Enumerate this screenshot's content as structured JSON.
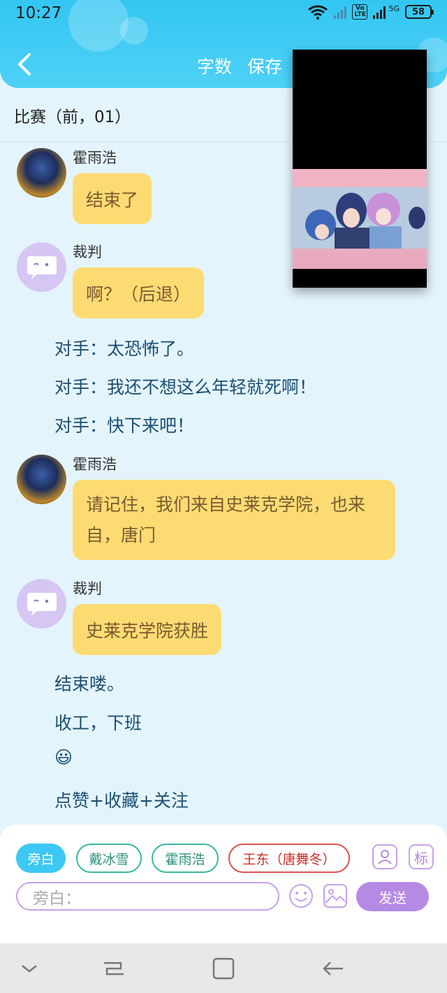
{
  "status_bar": {
    "time": "10:27",
    "network": "5G",
    "battery": "58",
    "volte": "Vo LTE"
  },
  "header": {
    "word_count": "字数",
    "save": "保存"
  },
  "chapter_title": "比赛（前，01）",
  "messages": [
    {
      "sender": "霍雨浩",
      "text": "结束了",
      "avatar": "huo-yuhao-avatar"
    },
    {
      "sender": "裁判",
      "text": "啊？（后退）",
      "avatar": "referee-avatar"
    },
    {
      "sender": "霍雨浩",
      "text": "请记住，我们来自史莱克学院，也来自，唐门",
      "avatar": "huo-yuhao-avatar"
    },
    {
      "sender": "裁判",
      "text": "史莱克学院获胜",
      "avatar": "referee-avatar"
    }
  ],
  "narration": [
    "对手：太恐怖了。",
    "对手：我还不想这么年轻就死啊！",
    "对手：快下来吧！",
    "结束喽。",
    "收工，下班",
    "😃",
    "点赞+收藏+关注"
  ],
  "role_chips": [
    "旁白",
    "戴冰雪",
    "霍雨浩",
    "王东（唐舞冬）"
  ],
  "tag_button": "标",
  "input": {
    "placeholder": "旁白："
  },
  "send_label": "发送"
}
